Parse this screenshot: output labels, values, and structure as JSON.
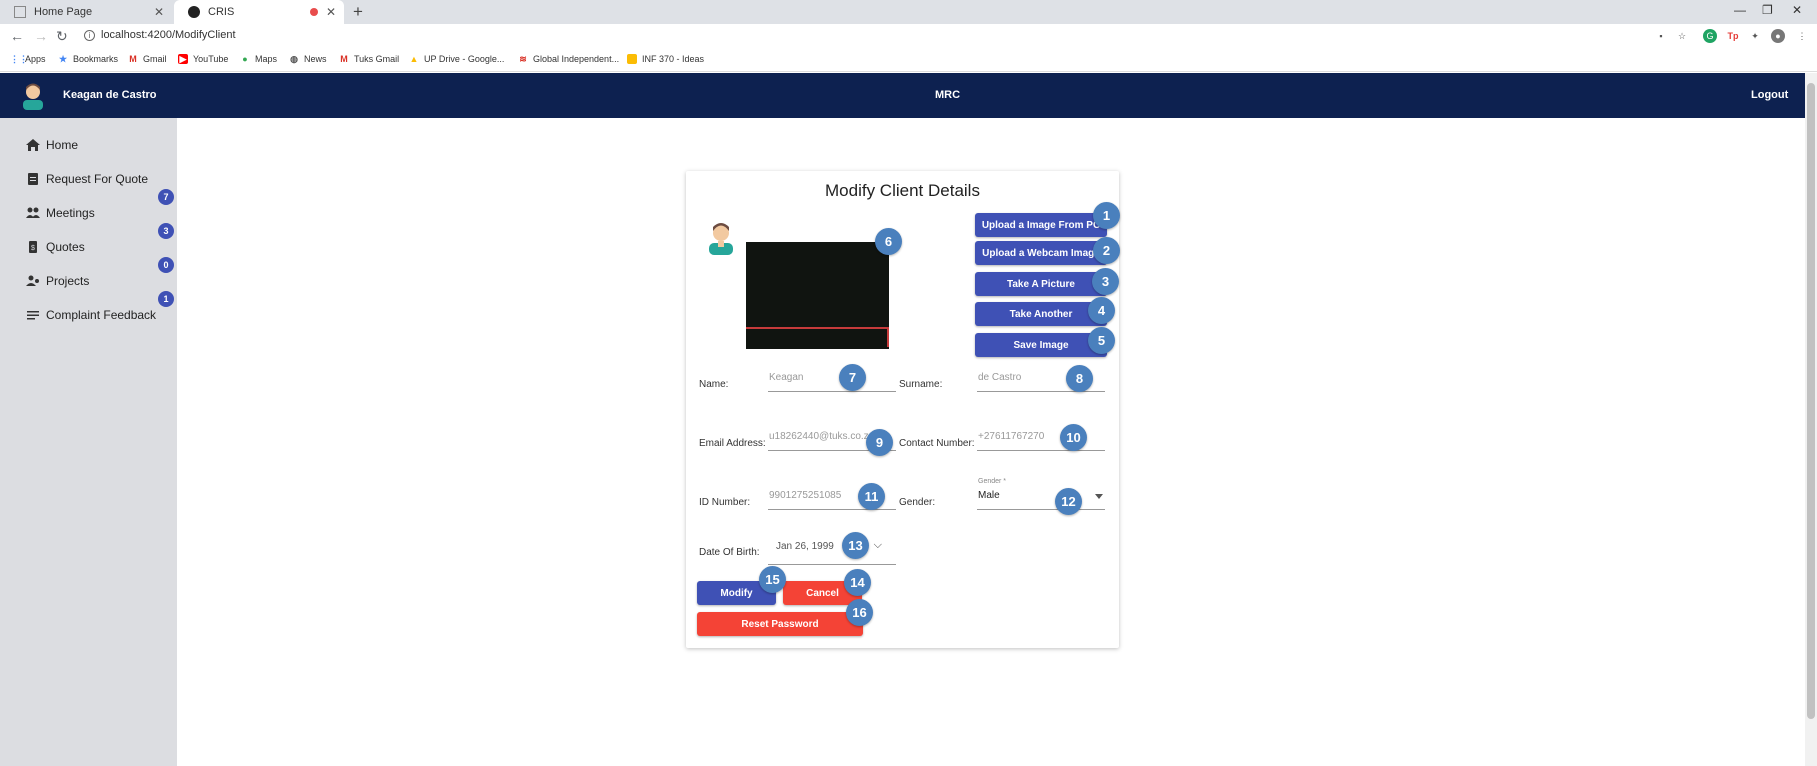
{
  "browser": {
    "tabs": [
      {
        "title": "Home Page"
      },
      {
        "title": "CRIS"
      }
    ],
    "url": "localhost:4200/ModifyClient",
    "bookmarks": [
      "Apps",
      "Bookmarks",
      "Gmail",
      "YouTube",
      "Maps",
      "News",
      "Tuks Gmail",
      "UP Drive - Google...",
      "Global Independent...",
      "INF 370 - Ideas"
    ]
  },
  "header": {
    "username": "Keagan de Castro",
    "app_name": "MRC",
    "logout_label": "Logout"
  },
  "sidebar": {
    "items": [
      {
        "label": "Home",
        "icon": "home-icon"
      },
      {
        "label": "Request For Quote",
        "icon": "clipboard-icon"
      },
      {
        "label": "Meetings",
        "icon": "people-icon"
      },
      {
        "label": "Quotes",
        "icon": "dollar-doc-icon"
      },
      {
        "label": "Projects",
        "icon": "person-gear-icon"
      },
      {
        "label": "Complaint Feedback",
        "icon": "list-icon"
      }
    ],
    "badges": [
      "7",
      "3",
      "0",
      "1"
    ]
  },
  "form": {
    "title": "Modify Client Details",
    "buttons": {
      "upload_pc": "Upload a Image From PC",
      "upload_webcam": "Upload a Webcam Image",
      "take_picture": "Take A Picture",
      "take_another": "Take Another",
      "save_image": "Save Image",
      "modify": "Modify",
      "cancel": "Cancel",
      "reset_password": "Reset Password"
    },
    "labels": {
      "name": "Name:",
      "surname": "Surname:",
      "email": "Email Address:",
      "contact": "Contact Number:",
      "id_number": "ID Number:",
      "gender": "Gender:",
      "dob": "Date Of Birth:"
    },
    "values": {
      "name": "Keagan",
      "surname": "de Castro",
      "email": "u18262440@tuks.co.za",
      "contact": "+27611767270",
      "id_number": "9901275251085",
      "gender_label": "Gender *",
      "gender": "Male",
      "dob": "Jan 26, 1999"
    }
  },
  "markers": [
    "1",
    "2",
    "3",
    "4",
    "5",
    "6",
    "7",
    "8",
    "9",
    "10",
    "11",
    "12",
    "13",
    "14",
    "15",
    "16"
  ],
  "colors": {
    "appbar": "#0d2150",
    "primary": "#3f51b5",
    "warn": "#f44336",
    "marker": "#4a80bd",
    "sidebar": "#dcdde1"
  }
}
